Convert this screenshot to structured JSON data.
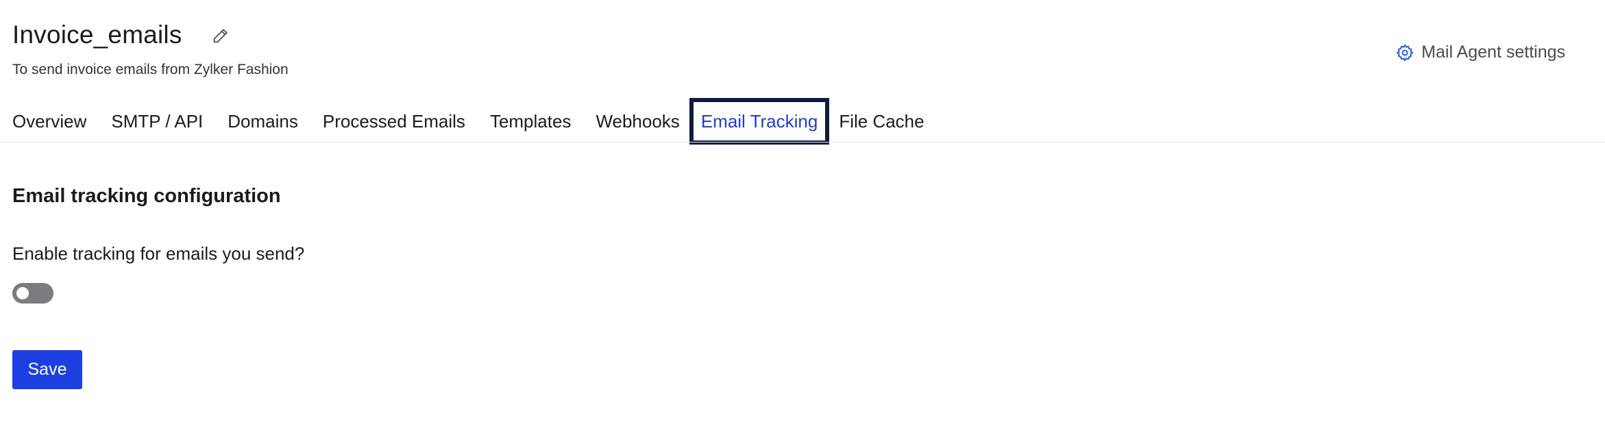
{
  "header": {
    "title": "Invoice_emails",
    "subtitle": "To send invoice emails from Zylker Fashion",
    "edit_icon": "pencil-icon",
    "settings_link": "Mail Agent settings",
    "settings_icon": "gear-icon"
  },
  "tabs": [
    {
      "label": "Overview",
      "active": false
    },
    {
      "label": "SMTP / API",
      "active": false
    },
    {
      "label": "Domains",
      "active": false
    },
    {
      "label": "Processed Emails",
      "active": false
    },
    {
      "label": "Templates",
      "active": false
    },
    {
      "label": "Webhooks",
      "active": false
    },
    {
      "label": "Email Tracking",
      "active": true
    },
    {
      "label": "File Cache",
      "active": false
    }
  ],
  "main": {
    "section_title": "Email tracking configuration",
    "question": "Enable tracking for emails you send?",
    "tracking_enabled": false,
    "save_label": "Save"
  },
  "colors": {
    "accent": "#1e3fe0",
    "active_tab_text": "#1f3ecf",
    "focus_border": "#0d1b3e",
    "toggle_off": "#7a7c82"
  }
}
